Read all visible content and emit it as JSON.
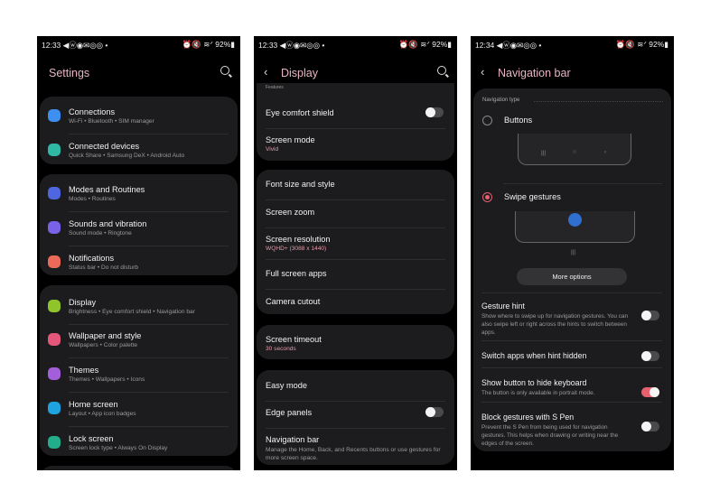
{
  "status": {
    "time1": "12:33",
    "time2": "12:33",
    "time3": "12:34",
    "icons_left": "◀ⓦ◉✉◎◎ •",
    "icons_right": "⏰🔇 ≋ᐟ 92%▮"
  },
  "settings": {
    "title": "Settings",
    "items": [
      {
        "label": "Connections",
        "sub": "Wi-Fi  •  Bluetooth  •  SIM manager",
        "color": "#3d8ff0",
        "icon": "wifi-icon"
      },
      {
        "label": "Connected devices",
        "sub": "Quick Share  •  Samsung DeX  •  Android Auto",
        "color": "#2fb8a6",
        "icon": "devices-icon"
      },
      {
        "label": "Modes and Routines",
        "sub": "Modes  •  Routines",
        "color": "#4f66e0",
        "icon": "check-circle-icon"
      },
      {
        "label": "Sounds and vibration",
        "sub": "Sound mode  •  Ringtone",
        "color": "#7a62e8",
        "icon": "speaker-icon"
      },
      {
        "label": "Notifications",
        "sub": "Status bar  •  Do not disturb",
        "color": "#ec6a5a",
        "icon": "notification-icon"
      },
      {
        "label": "Display",
        "sub": "Brightness  •  Eye comfort shield  •  Navigation bar",
        "color": "#8fc52a",
        "icon": "sun-icon"
      },
      {
        "label": "Wallpaper and style",
        "sub": "Wallpapers  •  Color palette",
        "color": "#e5577a",
        "icon": "image-icon"
      },
      {
        "label": "Themes",
        "sub": "Themes  •  Wallpapers  •  Icons",
        "color": "#a35fd9",
        "icon": "brush-icon"
      },
      {
        "label": "Home screen",
        "sub": "Layout  •  App icon badges",
        "color": "#1ea2e0",
        "icon": "home-icon"
      },
      {
        "label": "Lock screen",
        "sub": "Screen lock type  •  Always On Display",
        "color": "#22ae8a",
        "icon": "lock-icon"
      }
    ]
  },
  "display": {
    "title": "Display",
    "cut_text": "Features",
    "items": [
      {
        "label": "Eye comfort shield",
        "toggle": false
      },
      {
        "label": "Screen mode",
        "sub": "Vivid"
      },
      {
        "label": "Font size and style"
      },
      {
        "label": "Screen zoom"
      },
      {
        "label": "Screen resolution",
        "sub": "WQHD+ (3088 x 1440)"
      },
      {
        "label": "Full screen apps"
      },
      {
        "label": "Camera cutout"
      },
      {
        "label": "Screen timeout",
        "sub": "30 seconds"
      },
      {
        "label": "Easy mode"
      },
      {
        "label": "Edge panels",
        "toggle": false
      },
      {
        "label": "Navigation bar",
        "sub": "Manage the Home, Back, and Recents buttons or use gestures for more screen space."
      }
    ]
  },
  "navbar": {
    "title": "Navigation bar",
    "section": "Navigation type",
    "buttons_label": "Buttons",
    "buttons_selected": false,
    "nav_glyphs": [
      "|||",
      "○",
      "‹"
    ],
    "swipe_label": "Swipe gestures",
    "swipe_selected": true,
    "hint_glyph": "|||",
    "more_options": "More options",
    "items": [
      {
        "label": "Gesture hint",
        "sub": "Show where to swipe up for navigation gestures. You can also swipe left or right across the hints to switch between apps.",
        "toggle": false
      },
      {
        "label": "Switch apps when hint hidden",
        "toggle": false
      },
      {
        "label": "Show button to hide keyboard",
        "sub": "The button is only available in portrait mode.",
        "toggle": true
      },
      {
        "label": "Block gestures with S Pen",
        "sub": "Prevent the S Pen from being used for navigation gestures. This helps when drawing or writing near the edges of the screen.",
        "toggle": false
      }
    ]
  },
  "colors": {
    "accent": "#e6606f",
    "title": "#e9b5c2",
    "card": "#1c1c1e",
    "background": "#000000"
  }
}
